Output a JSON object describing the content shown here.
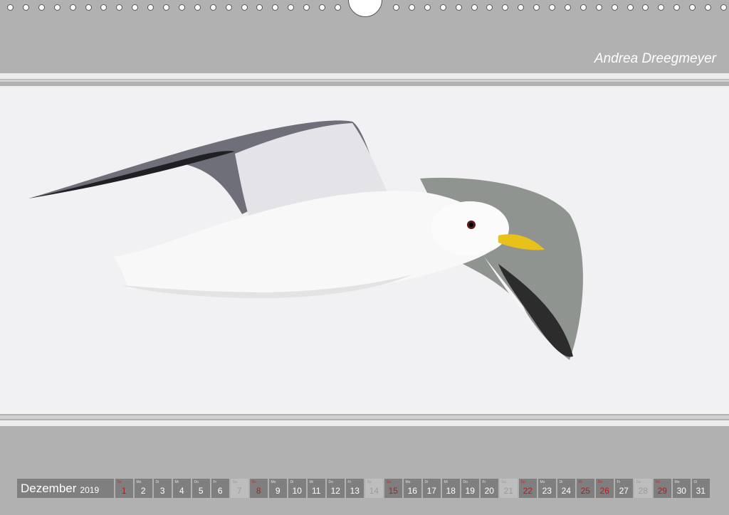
{
  "author": "Andrea Dreegmeyer",
  "calendar": {
    "month": "Dezember",
    "year": "2019",
    "days": [
      {
        "wd": "So",
        "n": "1",
        "t": "sun"
      },
      {
        "wd": "Mo",
        "n": "2",
        "t": "w"
      },
      {
        "wd": "Di",
        "n": "3",
        "t": "w"
      },
      {
        "wd": "Mi",
        "n": "4",
        "t": "w"
      },
      {
        "wd": "Do",
        "n": "5",
        "t": "w"
      },
      {
        "wd": "Fr",
        "n": "6",
        "t": "w"
      },
      {
        "wd": "Sa",
        "n": "7",
        "t": "sat"
      },
      {
        "wd": "So",
        "n": "8",
        "t": "sun"
      },
      {
        "wd": "Mo",
        "n": "9",
        "t": "w"
      },
      {
        "wd": "Di",
        "n": "10",
        "t": "w"
      },
      {
        "wd": "Mi",
        "n": "11",
        "t": "w"
      },
      {
        "wd": "Do",
        "n": "12",
        "t": "w"
      },
      {
        "wd": "Fr",
        "n": "13",
        "t": "w"
      },
      {
        "wd": "Sa",
        "n": "14",
        "t": "sat"
      },
      {
        "wd": "So",
        "n": "15",
        "t": "sun"
      },
      {
        "wd": "Mo",
        "n": "16",
        "t": "w"
      },
      {
        "wd": "Di",
        "n": "17",
        "t": "w"
      },
      {
        "wd": "Mi",
        "n": "18",
        "t": "w"
      },
      {
        "wd": "Do",
        "n": "19",
        "t": "w"
      },
      {
        "wd": "Fr",
        "n": "20",
        "t": "w"
      },
      {
        "wd": "Sa",
        "n": "21",
        "t": "sat"
      },
      {
        "wd": "So",
        "n": "22",
        "t": "sun"
      },
      {
        "wd": "Mo",
        "n": "23",
        "t": "w"
      },
      {
        "wd": "Di",
        "n": "24",
        "t": "w"
      },
      {
        "wd": "Mi",
        "n": "25",
        "t": "hol"
      },
      {
        "wd": "Do",
        "n": "26",
        "t": "hol"
      },
      {
        "wd": "Fr",
        "n": "27",
        "t": "w"
      },
      {
        "wd": "Sa",
        "n": "28",
        "t": "sat"
      },
      {
        "wd": "So",
        "n": "29",
        "t": "sun"
      },
      {
        "wd": "Mo",
        "n": "30",
        "t": "w"
      },
      {
        "wd": "Di",
        "n": "31",
        "t": "w"
      }
    ]
  }
}
